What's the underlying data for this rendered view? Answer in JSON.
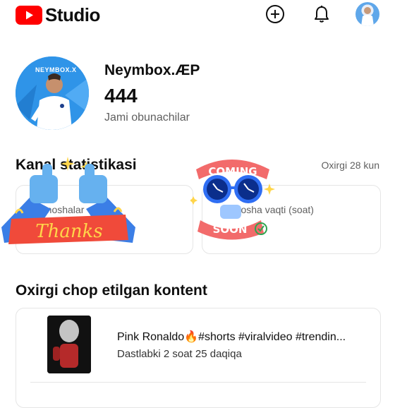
{
  "header": {
    "app_name": "Studio",
    "icons": [
      "youtube-logo-icon",
      "create-icon",
      "bell-icon",
      "account-avatar"
    ]
  },
  "channel": {
    "avatar_text": "NEYMBOX.X",
    "name": "Neymbox.ÆP",
    "subscriber_count": "444",
    "subscriber_label": "Jami obunachilar"
  },
  "stats": {
    "title": "Kanal statistikasi",
    "period": "Oxirgi 28 kun",
    "cards": [
      {
        "label": "Tomoshalar"
      },
      {
        "label": "Tomosha vaqti (soat)"
      }
    ]
  },
  "stickers": {
    "thanks": "Thanks",
    "coming": "COMING",
    "soon": "SOON"
  },
  "latest": {
    "title": "Oxirgi chop etilgan kontent",
    "video_title": "Pink Ronaldo🔥#shorts #viralvideo #trendin...",
    "video_time": "Dastlabki 2 soat 25 daqiqa"
  },
  "colors": {
    "youtube_red": "#ff0000",
    "thanks_blue": "#3b7ee6",
    "thanks_red": "#f04a3a",
    "thanks_yellow": "#ffd54a",
    "coming_pink": "#f26b6b",
    "glasses_blue": "#2f6ef3"
  }
}
